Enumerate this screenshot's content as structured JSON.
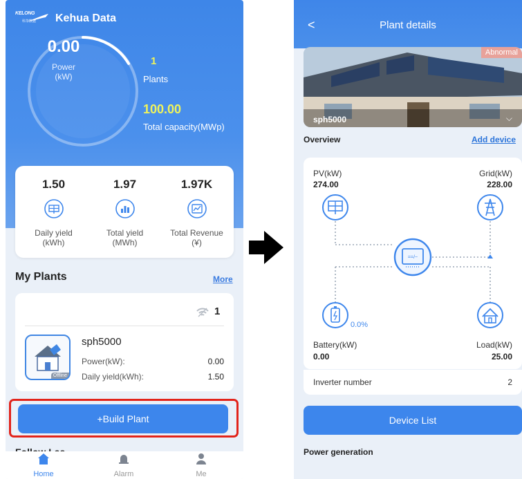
{
  "left": {
    "logo": {
      "main": "KELONG",
      "sub": "科华数据"
    },
    "app_title": "Kehua Data",
    "gauge": {
      "value": "0.00",
      "label_line1": "Power",
      "label_line2": "(kW)"
    },
    "plants": {
      "value": "1",
      "label": "Plants"
    },
    "capacity": {
      "value": "100.00",
      "label": "Total capacity(MWp)"
    },
    "yields": [
      {
        "value": "1.50",
        "label_line1": "Daily yield",
        "label_line2": "(kWh)",
        "icon": "solar-panel-icon"
      },
      {
        "value": "1.97",
        "label_line1": "Total yield",
        "label_line2": "(MWh)",
        "icon": "bar-chart-icon"
      },
      {
        "value": "1.97K",
        "label_line1": "Total Revenue",
        "label_line2": "(¥)",
        "icon": "revenue-chart-icon"
      }
    ],
    "my_plants": {
      "title": "My Plants",
      "more": "More"
    },
    "plant_card": {
      "count": "1",
      "name": "sph5000",
      "status": "Offline",
      "power_label": "Power(kW):",
      "power_value": "0.00",
      "daily_label": "Daily yield(kWh):",
      "daily_value": "1.50"
    },
    "build_button": "+Build Plant",
    "partial_section": "Follow Las",
    "tabs": [
      {
        "label": "Home",
        "icon": "home-icon",
        "active": true
      },
      {
        "label": "Alarm",
        "icon": "bell-icon",
        "active": false
      },
      {
        "label": "Me",
        "icon": "user-icon",
        "active": false
      }
    ]
  },
  "right": {
    "back": "<",
    "title": "Plant details",
    "hero": {
      "status": "Abnormal",
      "name": "sph5000",
      "chevron": "⌵"
    },
    "overview": {
      "title": "Overview",
      "add_device": "Add device"
    },
    "flow": {
      "pv_label": "PV(kW)",
      "pv_value": "274.00",
      "grid_label": "Grid(kW)",
      "grid_value": "228.00",
      "battery_label": "Battery(kW)",
      "battery_value": "0.00",
      "battery_soc": "0.0%",
      "load_label": "Load(kW)",
      "load_value": "25.00"
    },
    "inverter": {
      "label": "Inverter number",
      "value": "2"
    },
    "device_button": "Device List",
    "power_generation": "Power generation"
  },
  "colors": {
    "brand_blue": "#3d86ec",
    "highlight_red": "#e2231a",
    "stat_yellow": "#f1f45a",
    "link_blue": "#2b74da"
  }
}
